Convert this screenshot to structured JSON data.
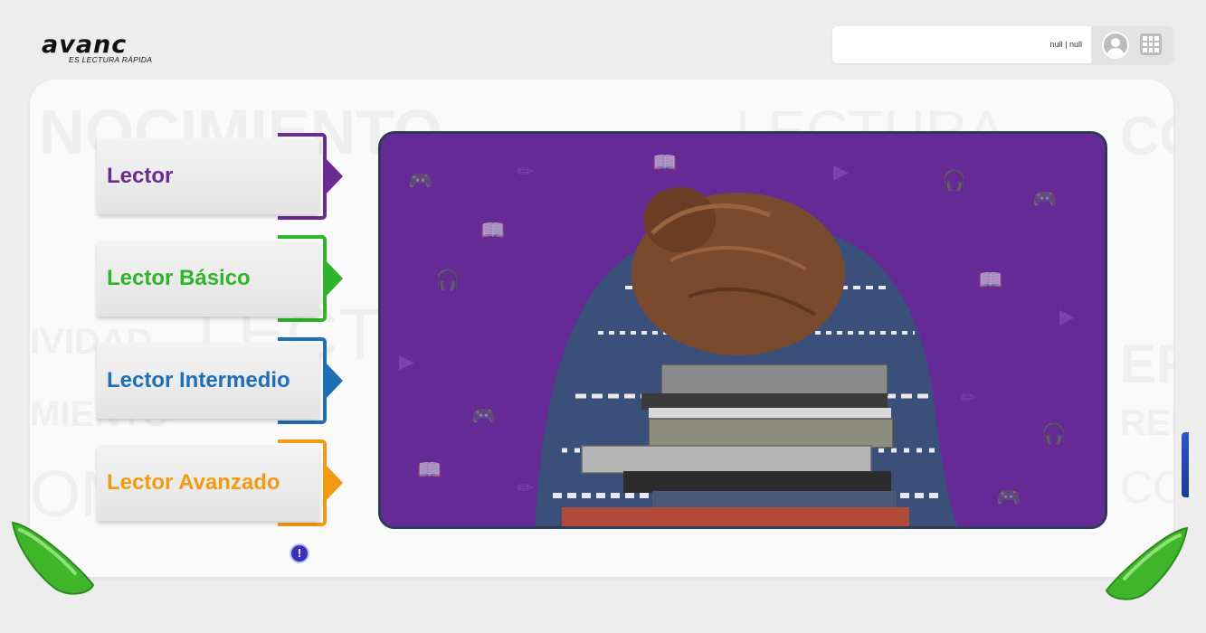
{
  "brand": {
    "logo_text": "avanc",
    "tagline": "ES LECTURA RÁPIDA",
    "accent": "#3fb52a"
  },
  "user": {
    "display": "null | null",
    "avatar_icon": "user-avatar-icon",
    "apps_icon": "grid-menu-icon"
  },
  "background_words": [
    "NOCIMIENTO",
    "LECTURA",
    "CO",
    "IVIDAD",
    "LECT",
    "EF",
    "MIENTO",
    "REN",
    "ONOC",
    "CO"
  ],
  "levels": [
    {
      "label": "Lector",
      "color": "#6a2c91"
    },
    {
      "label": "Lector Básico",
      "color": "#2fb52a"
    },
    {
      "label": "Lector Intermedio",
      "color": "#1e6fb5"
    },
    {
      "label": "Lector Avanzado",
      "color": "#f39a12"
    }
  ],
  "info_icon": "!",
  "hero": {
    "background": "#652a96",
    "image": "student-asleep-on-books"
  },
  "navigation": {
    "prev_icon": "arrow-left-icon",
    "next_icon": "arrow-right-icon",
    "color": "#3fb52a"
  }
}
